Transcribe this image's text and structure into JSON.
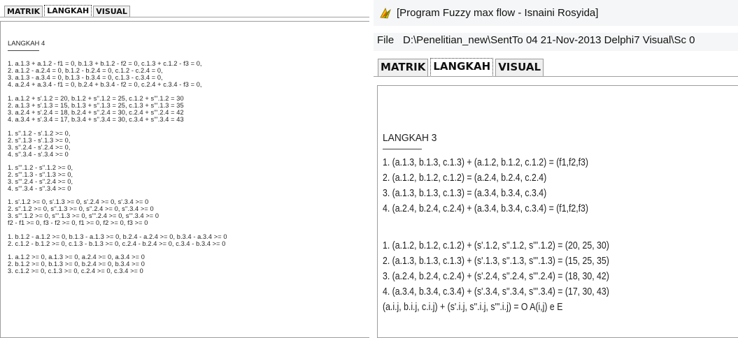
{
  "left_window": {
    "tabs": [
      {
        "label": "MATRIK",
        "active": false
      },
      {
        "label": "LANGKAH",
        "active": true
      },
      {
        "label": "VISUAL",
        "active": false
      }
    ],
    "heading": "LANGKAH 4",
    "lines": [
      "1.  a.1.3 + a.1.2 - f1 = 0,   b.1.3 + b.1.2 - f2 = 0,   c.1.3 + c.1.2 - f3 = 0,",
      "2.  a.1.2 - a.2.4 = 0,   b.1.2 - b.2.4 = 0,   c.1.2 - c.2.4 = 0,",
      "3.  a.1.3 - a.3.4 = 0,   b.1.3 - b.3.4 = 0,   c.1.3 - c.3.4 = 0,",
      "4.  a.2.4 + a.3.4 - f1 = 0,   b.2.4 + b.3.4 - f2 = 0,   c.2.4 + c.3.4 - f3 = 0,",
      "1.  a.1.2 + s'.1.2 = 20,   b.1.2 + s''.1.2 = 25,   c.1.2 + s'''.1.2 = 30",
      "2.  a.1.3 + s'.1.3 = 15,   b.1.3 + s''.1.3 = 25,   c.1.3 + s'''.1.3 = 35",
      "3.  a.2.4 + s'.2.4 = 18,   b.2.4 + s''.2.4 = 30,   c.2.4 + s'''.2.4 = 42",
      "4.  a.3.4 + s'.3.4 = 17,   b.3.4 + s''.3.4 = 30,   c.3.4 + s'''.3.4 = 43",
      "1.  s''.1.2 - s'.1.2 >= 0,",
      "2.  s''.1.3 - s'.1.3 >= 0,",
      "3.  s''.2.4 - s'.2.4 >= 0,",
      "4.  s''.3.4 - s'.3.4 >= 0",
      "1.  s'''.1.2 - s''.1.2 >= 0,",
      "2.  s'''.1.3 - s''.1.3 >= 0,",
      "3.  s'''.2.4 - s''.2.4 >= 0,",
      "4.  s'''.3.4 - s''.3.4 >= 0",
      "1.  s'.1.2 >= 0,   s'.1.3 >= 0,   s'.2.4 >= 0,   s'.3.4 >= 0",
      "2.  s''.1.2 >= 0,   s''.1.3 >= 0,   s''.2.4 >= 0,   s''.3.4 >= 0",
      "3.  s'''.1.2 >= 0,   s'''.1.3 >= 0,   s'''.2.4 >= 0,   s'''.3.4 >= 0",
      "f2 - f1 >= 0,   f3 - f2 >= 0,   f1 >= 0,   f2 >= 0,   f3 >= 0",
      "1.  b.1.2 - a.1.2 >= 0,   b.1.3 - a.1.3 >= 0,   b.2.4 - a.2.4 >= 0,   b.3.4 - a.3.4 >= 0",
      "2.  c.1.2 - b.1.2 >= 0,   c.1.3 - b.1.3 >= 0,   c.2.4 - b.2.4 >= 0,   c.3.4 - b.3.4 >= 0",
      "1.  a.1.2 >= 0,   a.1.3 >= 0,   a.2.4 >= 0,   a.3.4 >= 0",
      "2.  b.1.2 >= 0,   b.1.3 >= 0,   b.2.4 >= 0,   b.3.4 >= 0",
      "3.  c.1.2 >= 0,   c.1.3 >= 0,   c.2.4 >= 0,   c.3.4 >= 0"
    ]
  },
  "right_window": {
    "title": "[Program Fuzzy max flow - Isnaini Rosyida]",
    "app_icon": "delphi-app-icon",
    "menu": [
      "File",
      "D:\\Penelitian_new\\SentTo 04 21-Nov-2013 Delphi7 Visual\\Sc 0"
    ],
    "tabs": [
      {
        "label": "MATRIK",
        "active": false
      },
      {
        "label": "LANGKAH",
        "active": true
      },
      {
        "label": "VISUAL",
        "active": false
      }
    ],
    "heading": "LANGKAH 3",
    "lines": [
      "1. (a.1.3, b.1.3, c.1.3) + (a.1.2, b.1.2, c.1.2) = (f1,f2,f3)",
      "2. (a.1.2, b.1.2, c.1.2) = (a.2.4, b.2.4, c.2.4)",
      "3. (a.1.3, b.1.3, c.1.3) = (a.3.4, b.3.4, c.3.4)",
      "4. (a.2.4, b.2.4, c.2.4) + (a.3.4, b.3.4, c.3.4) = (f1,f2,f3)",
      "1.  (a.1.2, b.1.2, c.1.2) + (s'.1.2, s''.1.2, s'''.1.2) = (20, 25, 30)",
      "2.  (a.1.3, b.1.3, c.1.3) + (s'.1.3, s''.1.3, s'''.1.3) = (15, 25, 35)",
      "3.  (a.2.4, b.2.4, c.2.4) + (s'.2.4, s''.2.4, s'''.2.4) = (18, 30, 42)",
      "4.  (a.3.4, b.3.4, c.3.4) + (s'.3.4, s''.3.4, s'''.3.4) = (17, 30, 43)",
      "(a.i.j, b.i.j, c.i.j) + (s'.i.j, s''.i.j, s'''.i.j) =  O A(i,j) e E"
    ]
  }
}
